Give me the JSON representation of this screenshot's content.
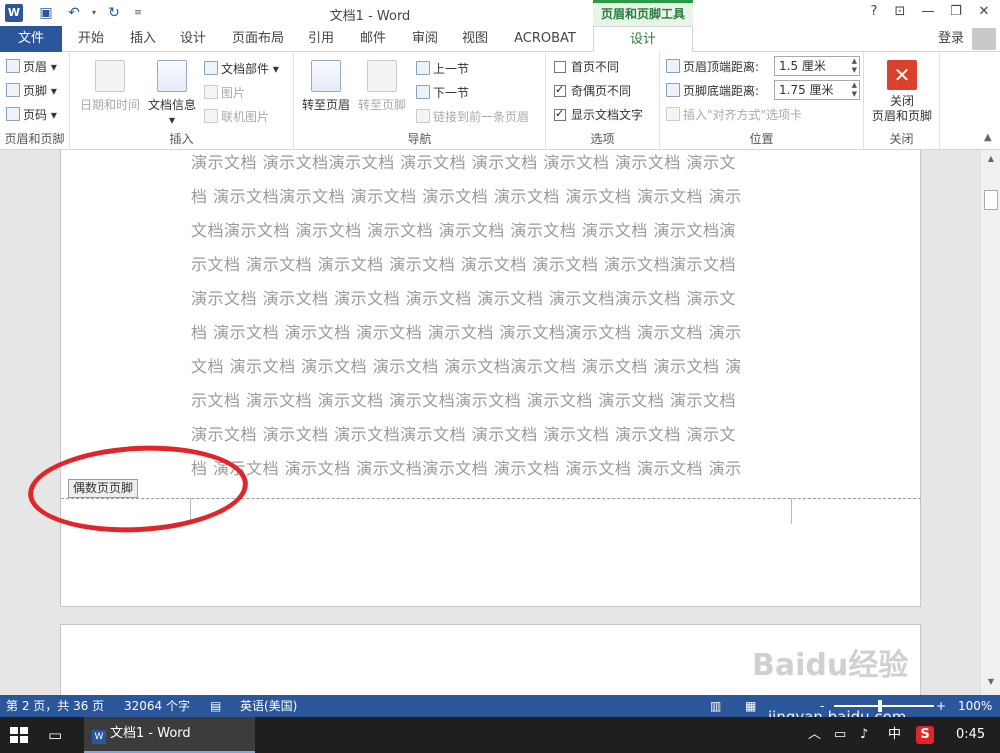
{
  "window": {
    "title": "文档1 - Word",
    "context_tool": "页眉和页脚工具",
    "help": "?",
    "restore_ribbon": "⊡",
    "minimize": "—",
    "maximize": "❐",
    "close": "✕"
  },
  "tabs": {
    "file": "文件",
    "items": [
      "开始",
      "插入",
      "设计",
      "页面布局",
      "引用",
      "邮件",
      "审阅",
      "视图",
      "ACROBAT",
      "设计"
    ],
    "active_index": 9,
    "login": "登录"
  },
  "ribbon": {
    "header_footer": {
      "header": "页眉",
      "footer": "页脚",
      "page_number": "页码",
      "label": "页眉和页脚"
    },
    "insert": {
      "date_time": "日期和时间",
      "doc_info": "文档信息",
      "doc_parts": "文档部件",
      "picture": "图片",
      "online_picture": "联机图片",
      "label": "插入"
    },
    "navigation": {
      "goto_header": "转至页眉",
      "goto_footer": "转至页脚",
      "prev_section": "上一节",
      "next_section": "下一节",
      "link_previous": "链接到前一条页眉",
      "label": "导航"
    },
    "options": {
      "different_first": "首页不同",
      "different_odd_even": "奇偶页不同",
      "show_doc_text": "显示文档文字",
      "label": "选项",
      "different_first_checked": false,
      "different_odd_even_checked": true,
      "show_doc_text_checked": true
    },
    "position": {
      "header_top_label": "页眉顶端距离:",
      "header_top_value": "1.5 厘米",
      "footer_bottom_label": "页脚底端距离:",
      "footer_bottom_value": "1.75 厘米",
      "insert_align_tab": "插入\"对齐方式\"选项卡",
      "label": "位置"
    },
    "close": {
      "button": "关闭\n页眉和页脚",
      "label": "关闭"
    }
  },
  "document": {
    "body_lines": [
      "演示文档 演示文档演示文档 演示文档 演示文档 演示文档 演示文档 演示文",
      "档 演示文档演示文档 演示文档 演示文档 演示文档 演示文档 演示文档 演示",
      "文档演示文档 演示文档 演示文档 演示文档 演示文档 演示文档 演示文档演",
      "示文档 演示文档 演示文档 演示文档 演示文档 演示文档 演示文档演示文档",
      "演示文档 演示文档 演示文档 演示文档 演示文档 演示文档演示文档 演示文",
      "档 演示文档 演示文档 演示文档 演示文档 演示文档演示文档 演示文档 演示",
      "文档 演示文档 演示文档 演示文档 演示文档演示文档 演示文档 演示文档 演",
      "示文档 演示文档 演示文档 演示文档演示文档 演示文档 演示文档 演示文档",
      "演示文档 演示文档 演示文档演示文档 演示文档 演示文档 演示文档 演示文",
      "档 演示文档 演示文档 演示文档演示文档 演示文档 演示文档 演示文档 演示"
    ],
    "footer_label": "偶数页页脚"
  },
  "status": {
    "page": "第 2 页，共 36 页",
    "words": "32064 个字",
    "language": "英语(美国)",
    "zoom": "100%",
    "zoom_minus": "-",
    "zoom_plus": "+"
  },
  "taskbar": {
    "app": "文档1 - Word",
    "ime": "中",
    "time": "0:45"
  },
  "watermark": {
    "brand": "Baidu经验",
    "url": "jingyan.baidu.com"
  }
}
